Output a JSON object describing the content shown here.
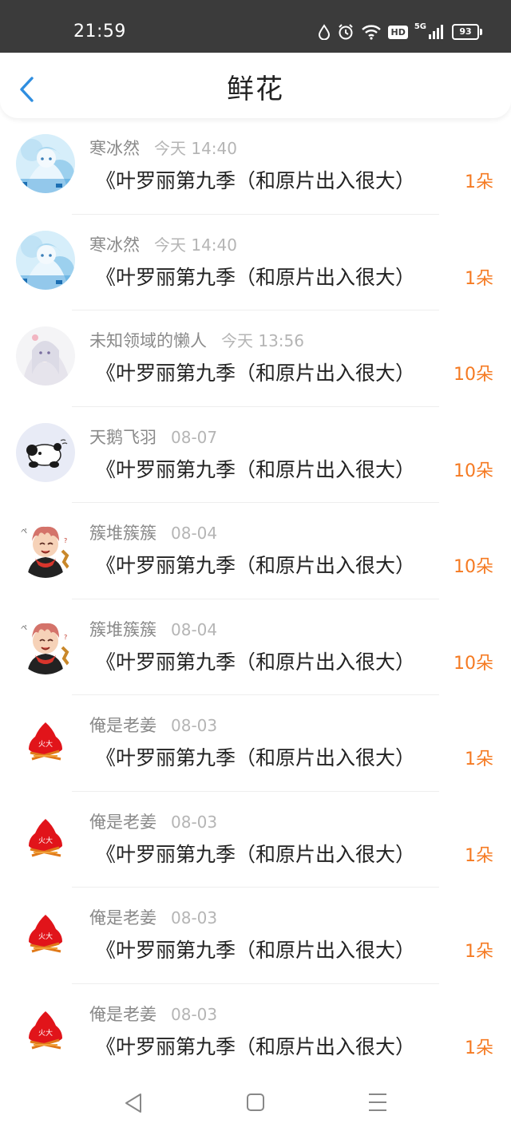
{
  "status_bar": {
    "time": "21:59",
    "signal_label": "5G",
    "hd_label": "HD",
    "battery": "93",
    "icons": [
      "water-drop-icon",
      "alarm-icon",
      "wifi-icon",
      "hd-icon",
      "signal-icon",
      "battery-icon"
    ]
  },
  "header": {
    "title": "鲜花",
    "back_icon": "chevron-left-icon",
    "accent_color": "#2f8ee0"
  },
  "count_color": "#f57a22",
  "items": [
    {
      "name": "寒冰然",
      "time": "今天 14:40",
      "title": "《叶罗丽第九季（和原片出入很大）",
      "count": "1朵",
      "avatar": "anime-blue"
    },
    {
      "name": "寒冰然",
      "time": "今天 14:40",
      "title": "《叶罗丽第九季（和原片出入很大）",
      "count": "1朵",
      "avatar": "anime-blue"
    },
    {
      "name": "未知领域的懒人",
      "time": "今天 13:56",
      "title": "《叶罗丽第九季（和原片出入很大）",
      "count": "10朵",
      "avatar": "anime-white"
    },
    {
      "name": "天鹅飞羽",
      "time": "08-07",
      "title": "《叶罗丽第九季（和原片出入很大）",
      "count": "10朵",
      "avatar": "panda"
    },
    {
      "name": "簇堆簇簇",
      "time": "08-04",
      "title": "《叶罗丽第九季（和原片出入很大）",
      "count": "10朵",
      "avatar": "chibi"
    },
    {
      "name": "簇堆簇簇",
      "time": "08-04",
      "title": "《叶罗丽第九季（和原片出入很大）",
      "count": "10朵",
      "avatar": "chibi"
    },
    {
      "name": "俺是老姜",
      "time": "08-03",
      "title": "《叶罗丽第九季（和原片出入很大）",
      "count": "1朵",
      "avatar": "fire-logo"
    },
    {
      "name": "俺是老姜",
      "time": "08-03",
      "title": "《叶罗丽第九季（和原片出入很大）",
      "count": "1朵",
      "avatar": "fire-logo"
    },
    {
      "name": "俺是老姜",
      "time": "08-03",
      "title": "《叶罗丽第九季（和原片出入很大）",
      "count": "1朵",
      "avatar": "fire-logo"
    },
    {
      "name": "俺是老姜",
      "time": "08-03",
      "title": "《叶罗丽第九季（和原片出入很大）",
      "count": "1朵",
      "avatar": "fire-logo"
    }
  ],
  "nav": {
    "icons": [
      "back-triangle-icon",
      "home-square-icon",
      "menu-lines-icon"
    ]
  }
}
